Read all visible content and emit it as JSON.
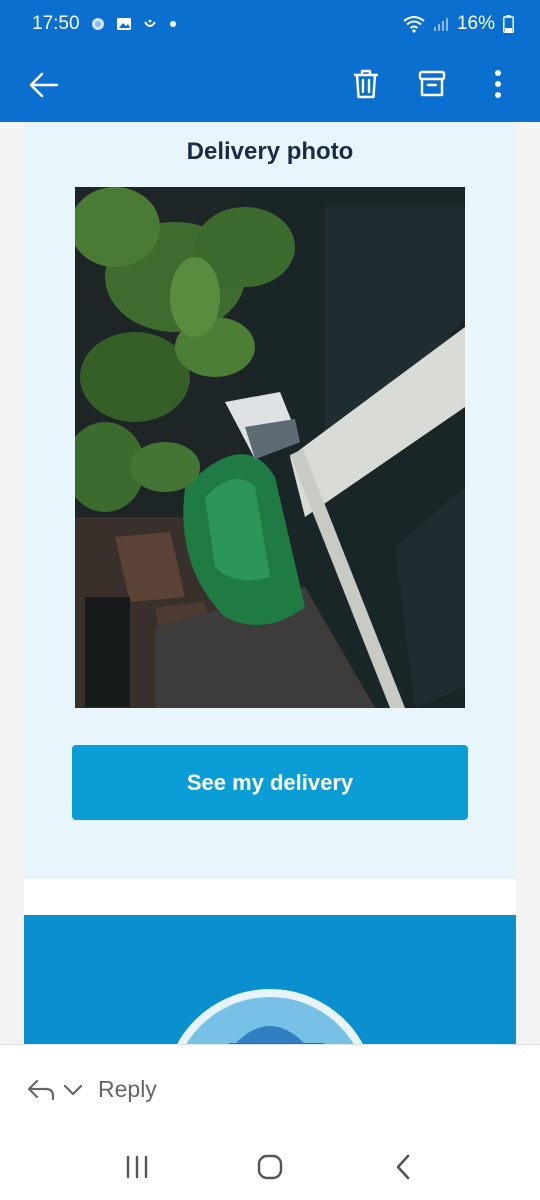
{
  "status_bar": {
    "time": "17:50",
    "battery": "16%",
    "icons": [
      "settings-dot-icon",
      "gallery-icon",
      "smile-icon",
      "notification-dot-icon",
      "wifi-icon",
      "signal-icon",
      "battery-icon"
    ]
  },
  "app_bar": {
    "back_icon": "arrow-left-icon",
    "actions": [
      "trash-icon",
      "archive-icon",
      "more-vertical-icon"
    ]
  },
  "email": {
    "photo_title": "Delivery photo",
    "cta_label": "See my delivery"
  },
  "reply_bar": {
    "label": "Reply",
    "icons": [
      "reply-arrow-icon",
      "chevron-down-icon"
    ]
  },
  "nav_bar": {
    "buttons": [
      "recent-apps-icon",
      "home-icon",
      "back-chevron-icon"
    ]
  },
  "colors": {
    "primary_blue": "#0b6fd0",
    "cta_blue": "#0b9ed6",
    "banner_blue": "#0b90cf",
    "card_bg": "#e8f6fb",
    "title_text": "#1b2a47"
  }
}
